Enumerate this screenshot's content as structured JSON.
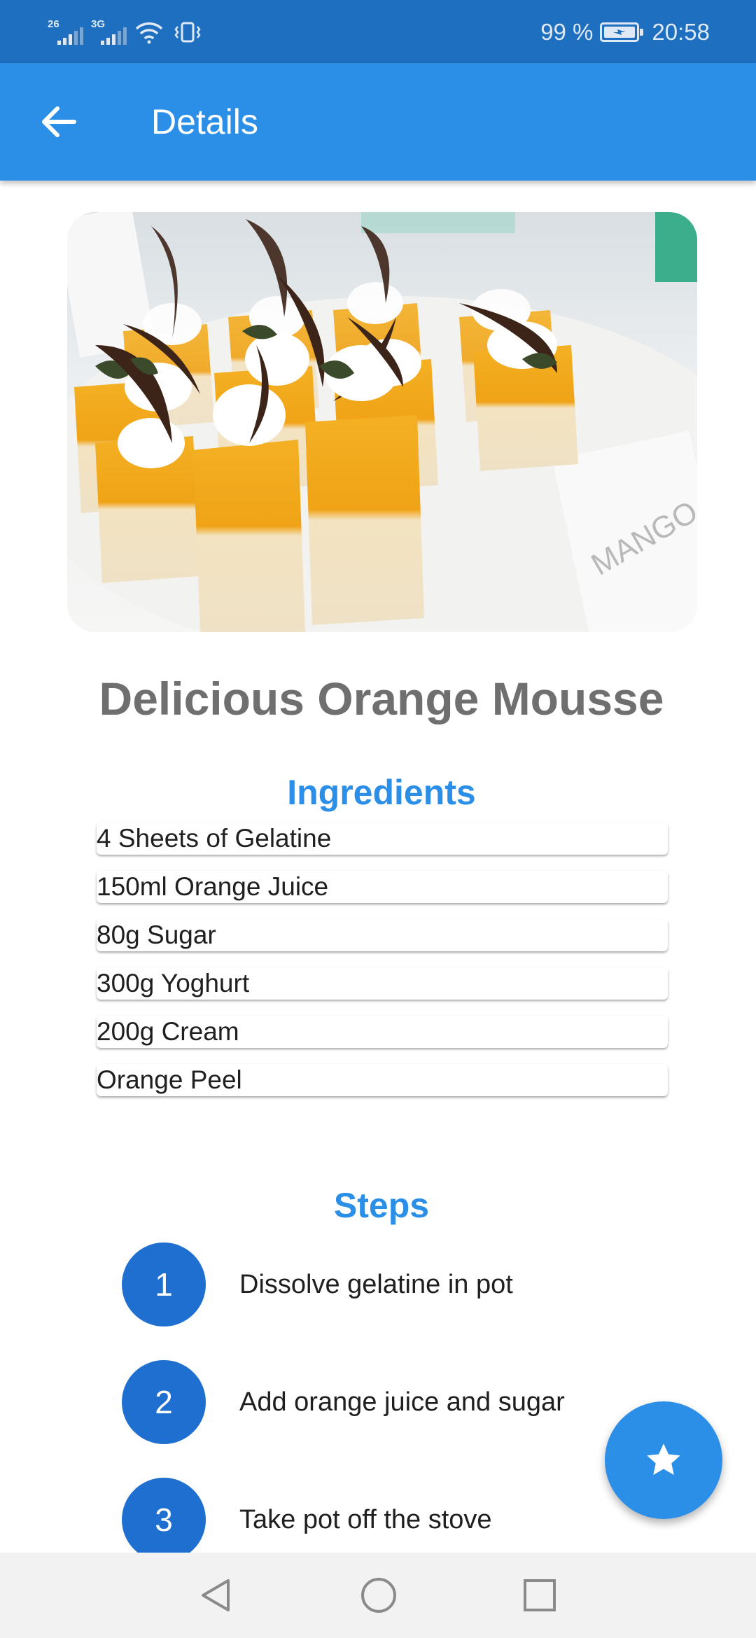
{
  "status_bar": {
    "network_1": "26",
    "network_2": "3G",
    "battery_text": "99 %",
    "time": "20:58",
    "icons": [
      "signal-icon",
      "signal-icon",
      "wifi-icon",
      "vibrate-icon",
      "battery-charging-icon"
    ]
  },
  "app_bar": {
    "title": "Details",
    "back_icon": "arrow-back-icon"
  },
  "hero_image": {
    "description_icon": "recipe-photo"
  },
  "recipe": {
    "title": "Delicious Orange Mousse",
    "ingredients_heading": "Ingredients",
    "ingredients": [
      "4 Sheets of Gelatine",
      "150ml Orange Juice",
      "80g Sugar",
      "300g Yoghurt",
      "200g Cream",
      "Orange Peel"
    ],
    "steps_heading": "Steps",
    "steps": [
      {
        "number": "1",
        "text": "Dissolve gelatine in pot"
      },
      {
        "number": "2",
        "text": "Add orange juice and sugar"
      },
      {
        "number": "3",
        "text": "Take pot off the stove"
      }
    ]
  },
  "fab": {
    "icon": "star-icon"
  },
  "nav_bar": {
    "icons": [
      "back-triangle-icon",
      "home-circle-icon",
      "recents-square-icon"
    ]
  },
  "colors": {
    "status_bar": "#1e6fbf",
    "app_bar": "#2b8fe8",
    "accent": "#2b8fe8",
    "step_circle": "#1e6fd0",
    "title_gray": "#6f6f6f"
  }
}
